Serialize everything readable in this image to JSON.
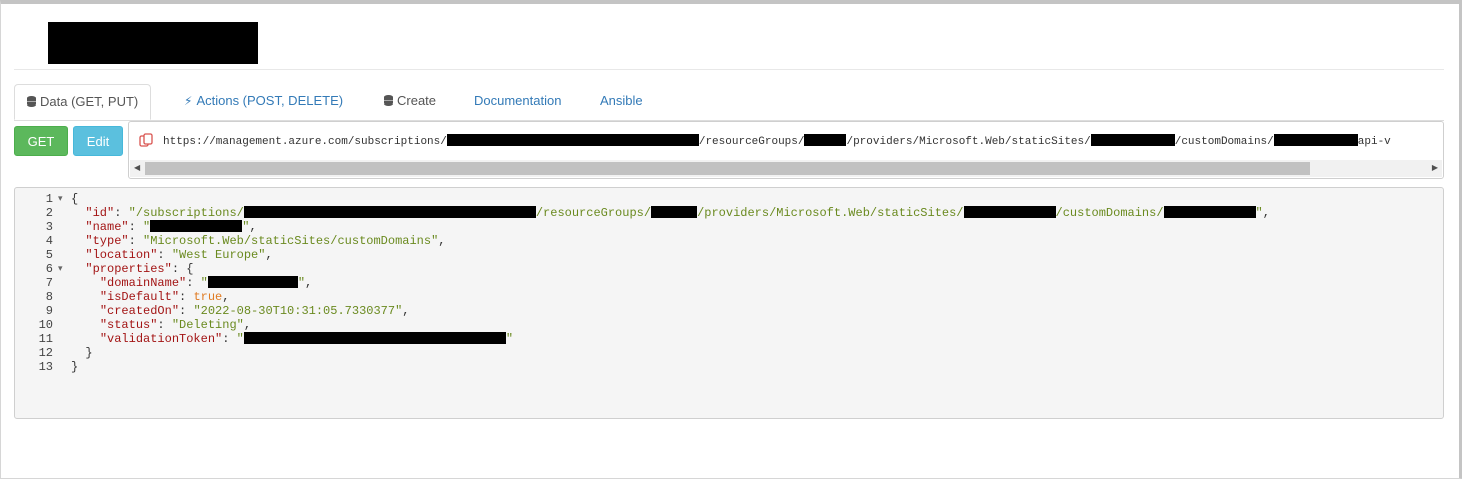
{
  "tabs": [
    {
      "label": "Data (GET, PUT)",
      "icon": "database-icon",
      "active": true
    },
    {
      "label": "Actions (POST, DELETE)",
      "icon": "bolt-icon",
      "active": false
    },
    {
      "label": "Create",
      "icon": "database-icon",
      "active": false
    },
    {
      "label": "Documentation",
      "active": false
    },
    {
      "label": "Ansible",
      "active": false
    }
  ],
  "buttons": {
    "get": "GET",
    "edit": "Edit"
  },
  "url": {
    "part1": "https://management.azure.com/subscriptions/",
    "part2": "/resourceGroups/",
    "part3": "/providers/Microsoft.Web/staticSites/",
    "part4": "/customDomains/",
    "part5": "api-v"
  },
  "json": {
    "line_numbers": [
      "1",
      "2",
      "3",
      "4",
      "5",
      "6",
      "7",
      "8",
      "9",
      "10",
      "11",
      "12",
      "13"
    ],
    "open_brace": "{",
    "close_brace": "}",
    "id_key": "\"id\"",
    "id_v1": "\"/subscriptions/",
    "id_v2": "/resourceGroups/",
    "id_v3": "/providers/Microsoft.Web/staticSites/",
    "id_v4": "/customDomains/",
    "name_key": "\"name\"",
    "type_key": "\"type\"",
    "type_val": "\"Microsoft.Web/staticSites/customDomains\"",
    "location_key": "\"location\"",
    "location_val": "\"West Europe\"",
    "properties_key": "\"properties\"",
    "domainName_key": "\"domainName\"",
    "isDefault_key": "\"isDefault\"",
    "isDefault_val": "true",
    "createdOn_key": "\"createdOn\"",
    "createdOn_val": "\"2022-08-30T10:31:05.7330377\"",
    "status_key": "\"status\"",
    "status_val": "\"Deleting\"",
    "validationToken_key": "\"validationToken\""
  }
}
